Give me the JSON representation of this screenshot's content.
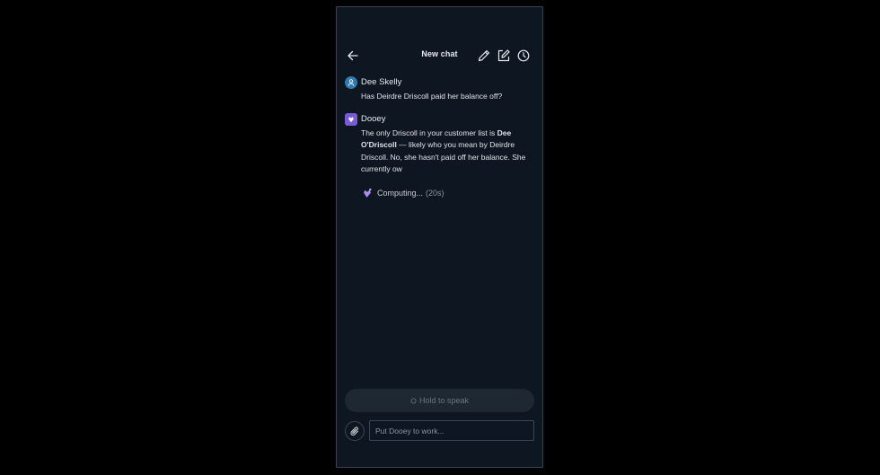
{
  "header": {
    "title": "New chat",
    "icons": [
      "arrow-left-icon",
      "pencil-icon",
      "compose-icon",
      "clock-icon"
    ]
  },
  "messages": [
    {
      "sender": "Dee Skelly",
      "role": "user",
      "text": "Has Deirdre Driscoll paid her balance off?"
    },
    {
      "sender": "Dooey",
      "role": "assistant",
      "text_before": "The only Driscoll in your customer list is ",
      "text_bold": "Dee O'Driscoll",
      "text_after": " — likely who you mean by Deirdre Driscoll. No, she hasn't paid off her balance. She currently ow"
    }
  ],
  "status": {
    "label": "Computing...",
    "elapsed": "(20s)"
  },
  "controls": {
    "hold_label": "Hold to speak",
    "input_placeholder": "Put Dooey to work..."
  },
  "colors": {
    "background": "#0e1621",
    "user_avatar": "#2f7bb0",
    "bot_avatar": "#7b5ad6"
  }
}
